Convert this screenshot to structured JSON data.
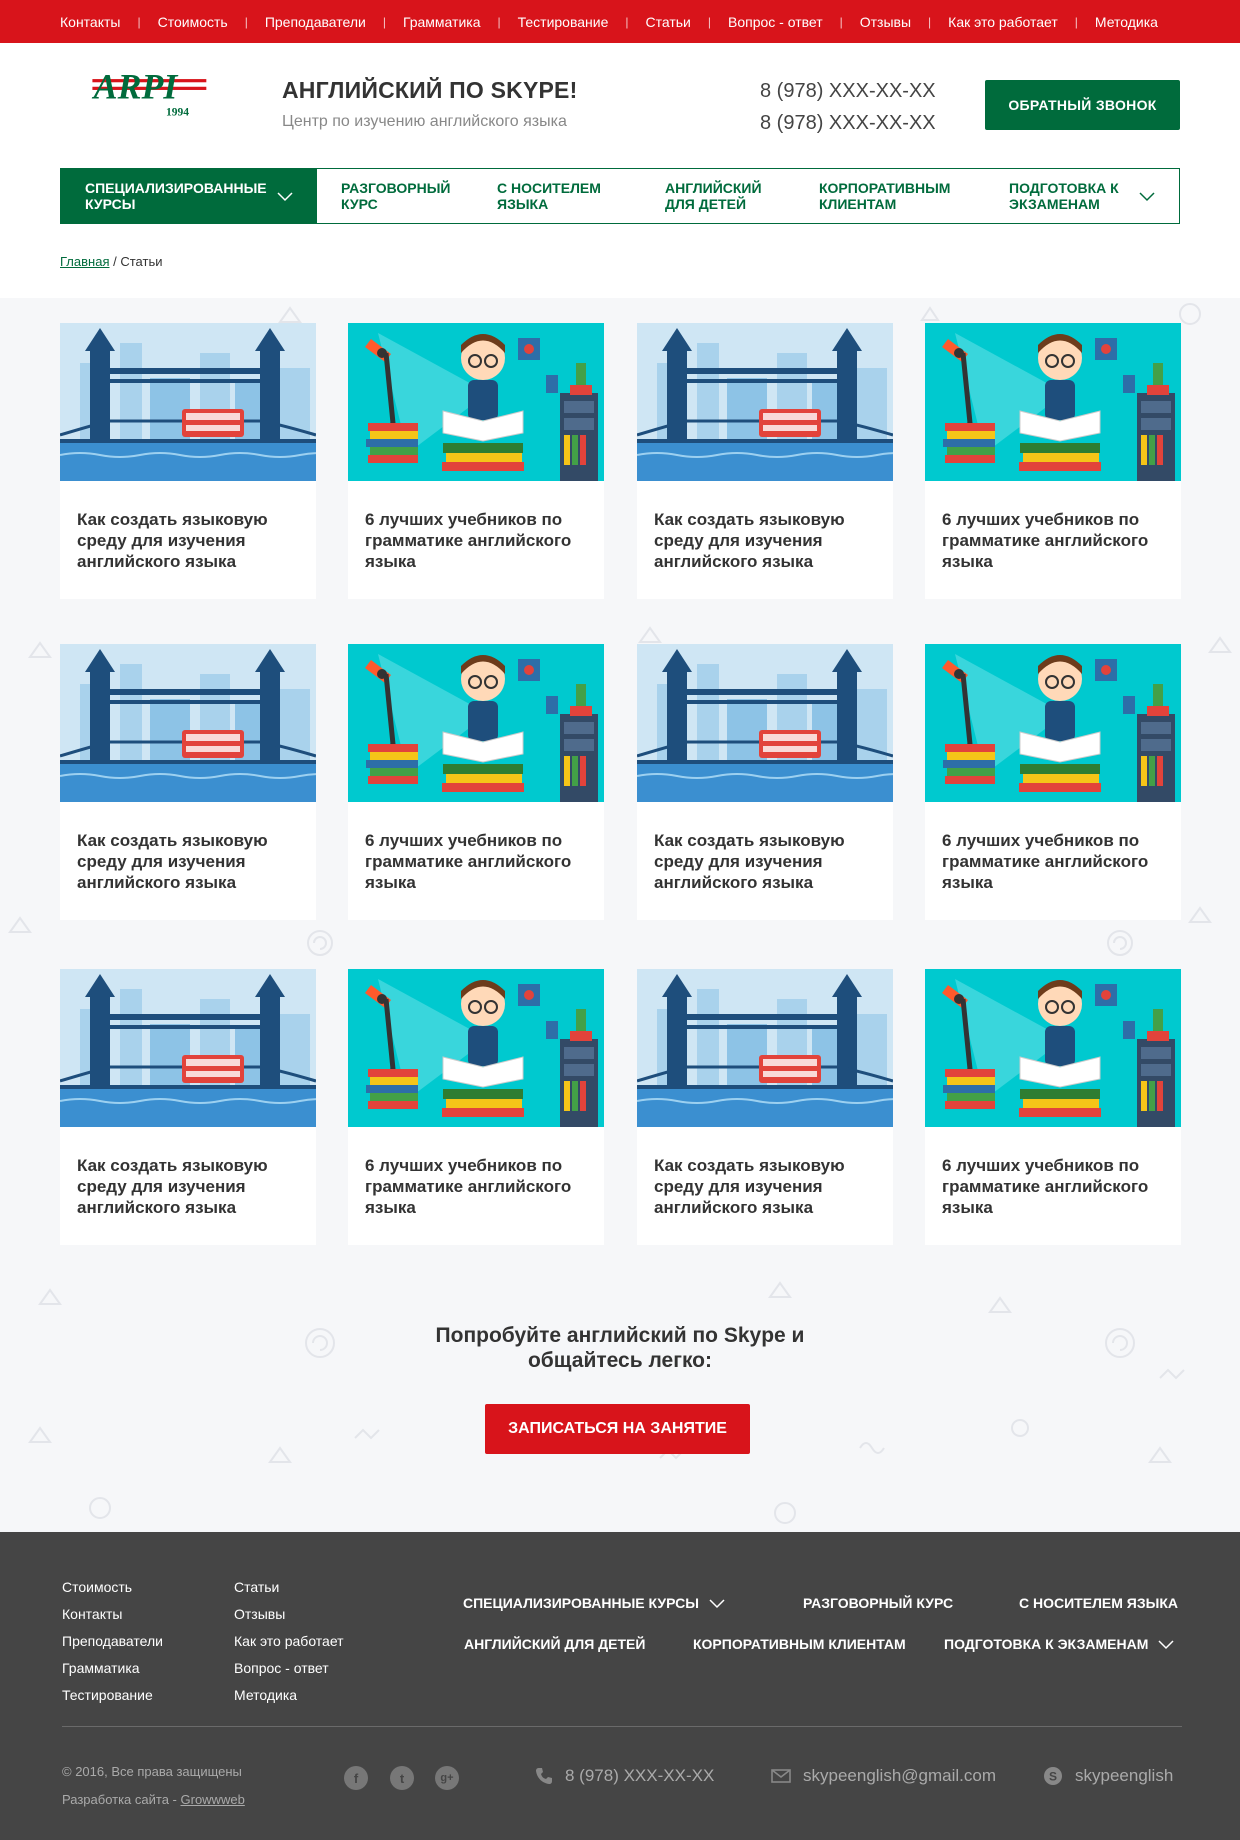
{
  "topbar": {
    "links": [
      "Контакты",
      "Стоимость",
      "Преподаватели",
      "Грамматика",
      "Тестирование",
      "Статьи",
      "Вопрос - ответ",
      "Отзывы",
      "Как это работает",
      "Методика"
    ]
  },
  "header": {
    "logo_text": "ARPI",
    "logo_year": "1994",
    "title": "АНГЛИЙСКИЙ ПО SKYPE!",
    "subtitle": "Центр по изучению английского языка",
    "phone1": "8 (978) XXX-XX-XX",
    "phone2": "8 (978) XXX-XX-XX",
    "callback_label": "ОБРАТНЫЙ ЗВОНОК"
  },
  "mainnav": {
    "items": [
      "СПЕЦИАЛИЗИРОВАННЫЕ КУРСЫ",
      "РАЗГОВОРНЫЙ КУРС",
      "С НОСИТЕЛЕМ ЯЗЫКА",
      "АНГЛИЙСКИЙ ДЛЯ ДЕТЕЙ",
      "КОРПОРАТИВНЫМ КЛИЕНТАМ",
      "ПОДГОТОВКА К ЭКЗАМЕНАМ"
    ]
  },
  "breadcrumb": {
    "home": "Главная",
    "separator": "/",
    "current": "Статьи"
  },
  "articles": [
    "Как создать языковую среду для изучения английского языка",
    "6 лучших учебников по грамматике английского языка",
    "Как создать языковую среду для изучения английского языка",
    "6 лучших учебников по грамматике английского языка",
    "Как создать языковую среду для изучения английского языка",
    "6 лучших учебников по грамматике английского языка",
    "Как создать языковую среду для изучения английского языка",
    "6 лучших учебников по грамматике английского языка",
    "Как создать языковую среду для изучения английского языка",
    "6 лучших учебников по грамматике английского языка",
    "Как создать языковую среду для изучения английского языка",
    "6 лучших учебников по грамматике английского языка"
  ],
  "cta": {
    "line1": "Попробуйте английский по Skype и",
    "line2": "общайтесь легко:",
    "button": "ЗАПИСАТЬСЯ НА ЗАНЯТИЕ"
  },
  "footer": {
    "col1": [
      "Стоимость",
      "Контакты",
      "Преподаватели",
      "Грамматика",
      "Тестирование"
    ],
    "col2": [
      "Статьи",
      "Отзывы",
      "Как это работает",
      "Вопрос - ответ",
      "Методика"
    ],
    "nav": [
      "СПЕЦИАЛИЗИРОВАННЫЕ КУРСЫ",
      "РАЗГОВОРНЫЙ КУРС",
      "С НОСИТЕЛЕМ ЯЗЫКА",
      "АНГЛИЙСКИЙ ДЛЯ ДЕТЕЙ",
      "КОРПОРАТИВНЫМ КЛИЕНТАМ",
      "ПОДГОТОВКА К ЭКЗАМЕНАМ"
    ],
    "copyright": "© 2016, Все права защищены",
    "dev_prefix": "Разработка сайта - ",
    "dev_link": "Growwweb",
    "social": [
      "f",
      "t",
      "g+"
    ],
    "phone": "8 (978) XXX-XX-XX",
    "email": "skypeenglish@gmail.com",
    "skype": "skypeenglish"
  },
  "colors": {
    "brand_red": "#d8141b",
    "brand_green": "#006b3c",
    "footer_bg": "#454545",
    "content_bg": "#f6f7f9"
  }
}
